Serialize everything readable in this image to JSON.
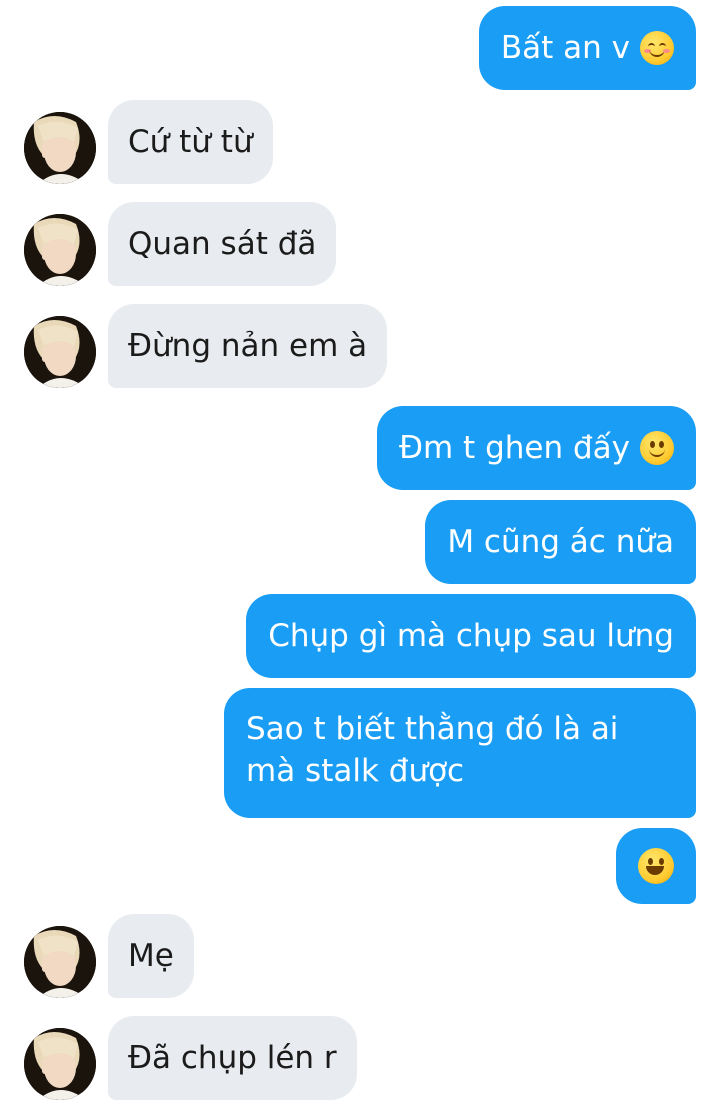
{
  "conversation": {
    "messages": [
      {
        "side": "out",
        "text": "Bất an v",
        "emoji": "smiling-blush-emoji"
      },
      {
        "side": "in",
        "text": "Cứ từ từ"
      },
      {
        "side": "in",
        "text": "Quan sát đã"
      },
      {
        "side": "in",
        "text": "Đừng nản em à"
      },
      {
        "side": "out",
        "text": "Đm t ghen đấy",
        "emoji": "slight-smile-emoji"
      },
      {
        "side": "out",
        "text": "M cũng ác nữa"
      },
      {
        "side": "out",
        "text": "Chụp gì mà chụp sau lưng"
      },
      {
        "side": "out",
        "text": "Sao t biết thằng đó là ai mà stalk được"
      },
      {
        "side": "out",
        "text": "",
        "emoji": "grinning-emoji"
      },
      {
        "side": "in",
        "text": "Mẹ"
      },
      {
        "side": "in",
        "text": "Đã chụp lén r"
      }
    ]
  },
  "colors": {
    "outgoing_bubble": "#1a9df4",
    "incoming_bubble": "#e8ebef",
    "background": "#ffffff"
  }
}
